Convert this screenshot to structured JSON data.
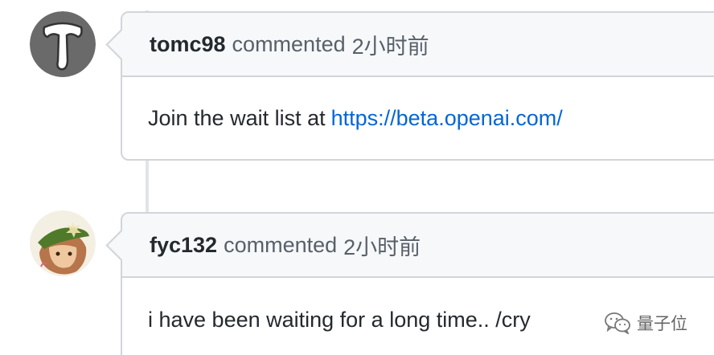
{
  "comments": [
    {
      "author": "tomc98",
      "action": "commented",
      "time": "2小时前",
      "body_text": "Join the wait list at",
      "body_link": "https://beta.openai.com/",
      "avatar_letter": "T"
    },
    {
      "author": "fyc132",
      "action": "commented",
      "time": "2小时前",
      "body_text": "i have been waiting for a long time.. /cry",
      "avatar_letter": ""
    }
  ],
  "watermark": {
    "text": "量子位"
  },
  "colors": {
    "link": "#0366d6",
    "header_bg": "#f6f8fa",
    "border": "#d1d5da",
    "timeline": "#e1e4e8",
    "avatar_gray": "#6a6a6a"
  },
  "icons": [
    "wechat-icon"
  ]
}
